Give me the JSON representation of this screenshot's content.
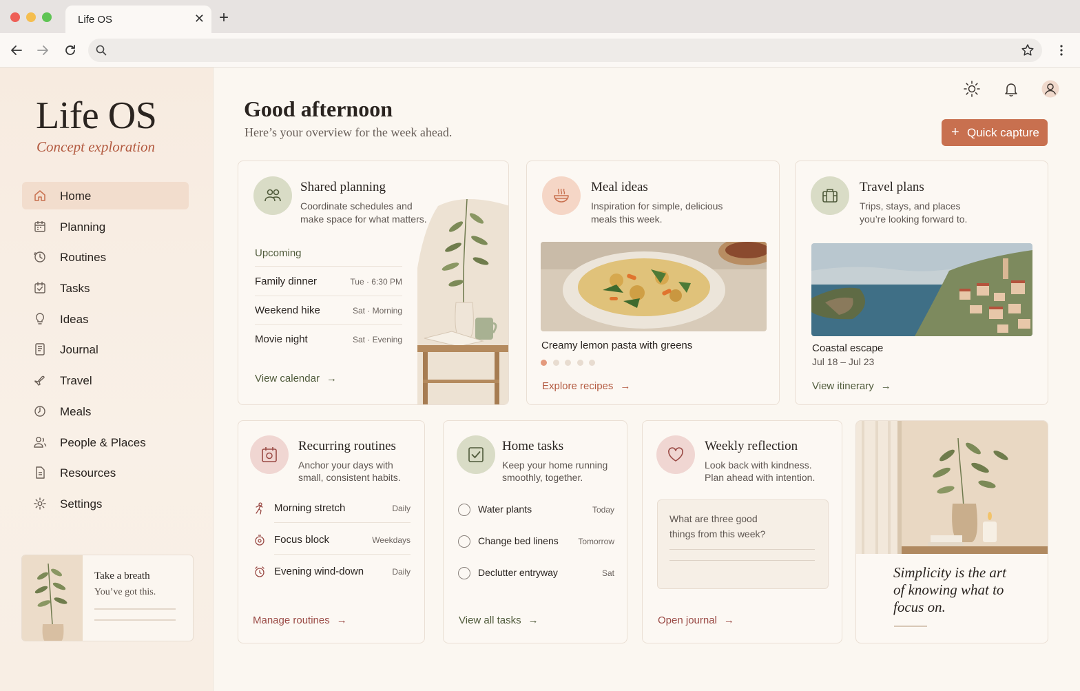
{
  "browser": {
    "tab_title": "Life OS",
    "tab_close": "✕",
    "new_tab": "+"
  },
  "sidebar": {
    "brand": "Life OS",
    "brand_sub": "Concept exploration",
    "items": [
      {
        "label": "Home",
        "icon": "home-icon"
      },
      {
        "label": "Planning",
        "icon": "calendar-icon"
      },
      {
        "label": "Routines",
        "icon": "routine-icon"
      },
      {
        "label": "Tasks",
        "icon": "task-icon"
      },
      {
        "label": "Ideas",
        "icon": "lightbulb-icon"
      },
      {
        "label": "Journal",
        "icon": "journal-icon"
      },
      {
        "label": "Travel",
        "icon": "plane-icon"
      },
      {
        "label": "Meals",
        "icon": "clock-icon"
      },
      {
        "label": "People & Places",
        "icon": "people-icon"
      },
      {
        "label": "Resources",
        "icon": "document-icon"
      },
      {
        "label": "Settings",
        "icon": "gear-icon"
      }
    ],
    "breath_title": "Take a breath",
    "breath_sub": "You’ve got this."
  },
  "header": {
    "greeting": "Good afternoon",
    "subtitle": "Here’s your overview for the week ahead.",
    "quick_capture": "Quick capture",
    "quick_plus": "+"
  },
  "shared_planning": {
    "title": "Shared planning",
    "desc1": "Coordinate schedules and",
    "desc2": "make space for what matters.",
    "upcoming": "Upcoming",
    "events": [
      {
        "name": "Family dinner",
        "when": "Tue · 6:30 PM"
      },
      {
        "name": "Weekend hike",
        "when": "Sat · Morning"
      },
      {
        "name": "Movie night",
        "when": "Sat · Evening"
      }
    ],
    "link": "View calendar"
  },
  "meal_ideas": {
    "title": "Meal ideas",
    "desc1": "Inspiration for simple, delicious",
    "desc2": "meals this week.",
    "caption": "Creamy lemon pasta with greens",
    "link": "Explore recipes"
  },
  "travel_plans": {
    "title": "Travel plans",
    "desc1": "Trips, stays, and places",
    "desc2": "you’re looking forward to.",
    "trip": "Coastal escape",
    "dates": "Jul 18 – Jul 23",
    "link": "View itinerary"
  },
  "routines": {
    "title": "Recurring routines",
    "desc1": "Anchor your days with",
    "desc2": "small, consistent habits.",
    "items": [
      {
        "name": "Morning stretch",
        "freq": "Daily"
      },
      {
        "name": "Focus block",
        "freq": "Weekdays"
      },
      {
        "name": "Evening wind-down",
        "freq": "Daily"
      }
    ],
    "link": "Manage routines"
  },
  "home_tasks": {
    "title": "Home tasks",
    "desc1": "Keep your home running",
    "desc2": "smoothly, together.",
    "items": [
      {
        "name": "Water plants",
        "due": "Today"
      },
      {
        "name": "Change bed linens",
        "due": "Tomorrow"
      },
      {
        "name": "Declutter entryway",
        "due": "Sat"
      }
    ],
    "link": "View all tasks"
  },
  "reflection": {
    "title": "Weekly reflection",
    "desc1": "Look back with kindness.",
    "desc2": "Plan ahead with intention.",
    "prompt1": "What are three good",
    "prompt2": "things from this week?",
    "link": "Open journal"
  },
  "quote": {
    "line1": "Simplicity is the art",
    "line2": "of knowing what to",
    "line3": "focus on."
  },
  "arrow": "→",
  "colors": {
    "accent": "#c8704f",
    "terracotta_text": "#b35a40",
    "olive_text": "#4f5a3a",
    "rose_text": "#9a4a45",
    "active_nav": "#f2ddcd"
  }
}
